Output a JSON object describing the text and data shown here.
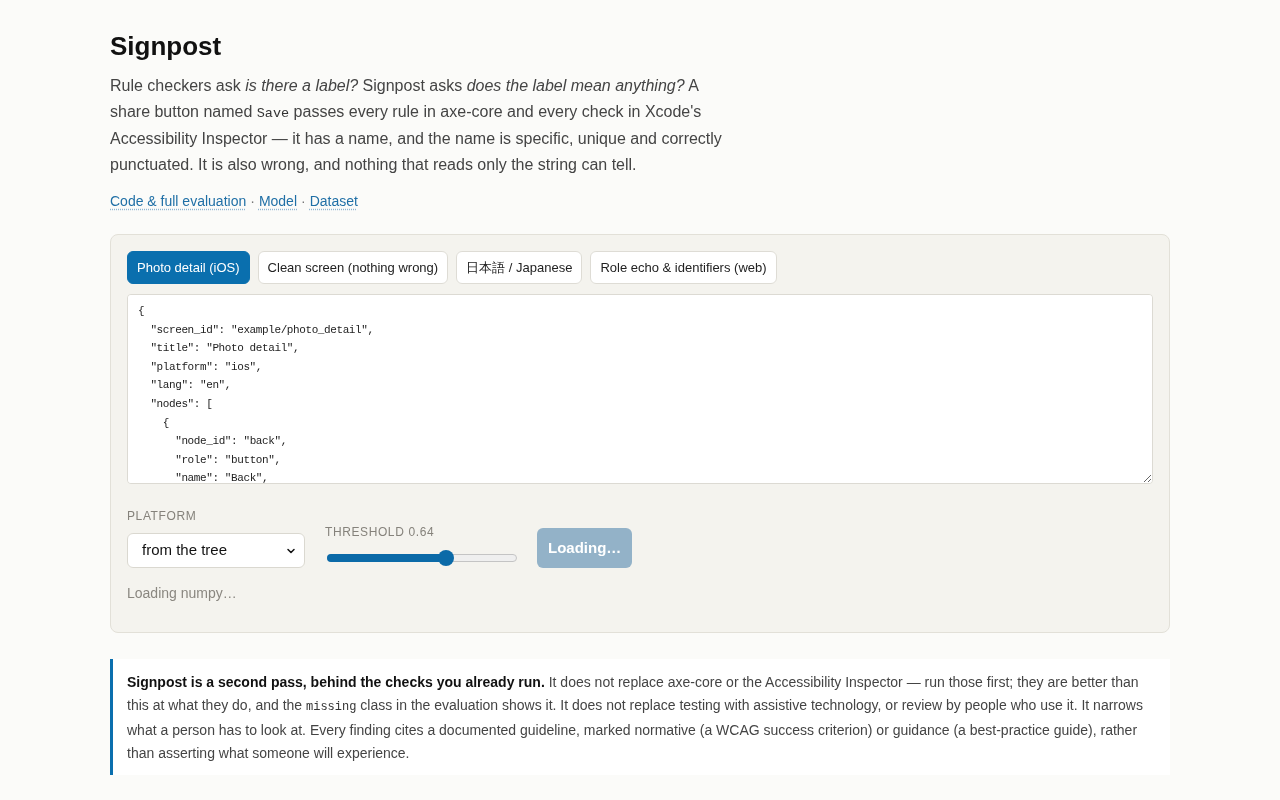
{
  "header": {
    "title": "Signpost",
    "intro": [
      {
        "kind": "text",
        "text": "Rule checkers ask *is there a label?* Signpost asks *does the label mean anything?* A share button named "
      },
      {
        "kind": "code",
        "text": "Save"
      },
      {
        "kind": "text",
        "text": " passes every rule in axe-core and every check in Xcode's Accessibility Inspector — it has a name, and the name is specific, unique and correctly punctuated. It is also wrong, and nothing that reads only the string can tell."
      }
    ],
    "links": [
      {
        "kind": "link",
        "label": "Code & full evaluation"
      },
      {
        "kind": "separator",
        "label": "·"
      },
      {
        "kind": "link",
        "label": "Model"
      },
      {
        "kind": "separator",
        "label": "·"
      },
      {
        "kind": "link",
        "label": "Dataset"
      }
    ]
  },
  "demo": {
    "tabs": [
      {
        "label": "Photo detail (iOS)",
        "selected": true
      },
      {
        "label": "Clean screen (nothing wrong)",
        "selected": false
      },
      {
        "label": "日本語 / Japanese",
        "selected": false
      },
      {
        "label": "Role echo & identifiers (web)",
        "selected": false
      }
    ],
    "editor": {
      "lines": [
        "{",
        "  \"screen_id\": \"example/photo_detail\",",
        "  \"title\": \"Photo detail\",",
        "  \"platform\": \"ios\",",
        "  \"lang\": \"en\",",
        "  \"nodes\": [",
        "    {",
        "      \"node_id\": \"back\",",
        "      \"role\": \"button\",",
        "      \"name\": \"Back\","
      ]
    },
    "platform": {
      "label": "PLATFORM",
      "value": "from the tree"
    },
    "threshold": {
      "label": "THRESHOLD",
      "reading": "0.64",
      "level": 0.64
    },
    "run_button": {
      "label": "Loading…",
      "disabled": true
    },
    "status": "Loading numpy…"
  },
  "note": {
    "segments": [
      {
        "kind": "bold",
        "text": "Signpost is a second pass, behind the checks you already run."
      },
      {
        "kind": "text",
        "text": " It does not replace axe-core or the Accessibility Inspector — run those first; they are better than this at what they do, and the "
      },
      {
        "kind": "code",
        "text": "missing"
      },
      {
        "kind": "text",
        "text": " class in the evaluation shows it. It does not replace testing with assistive technology, or review by people who use it. It narrows what a person has to look at. Every finding cites a documented guideline, marked normative (a WCAG success criterion) or guidance (a best-practice guide), rather than asserting what someone will experience."
      }
    ]
  }
}
